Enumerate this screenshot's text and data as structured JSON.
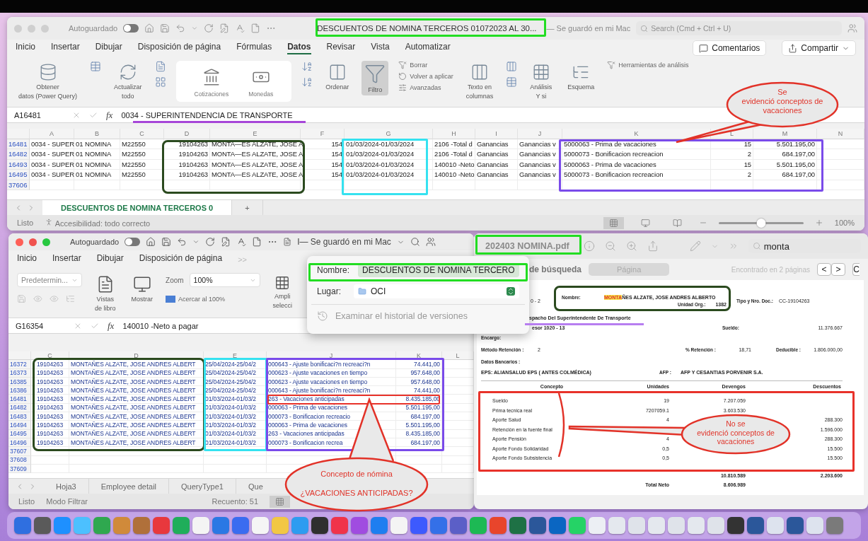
{
  "top_window": {
    "autosave": {
      "label": "Autoguardado",
      "on": false
    },
    "title": "DESCUENTOS DE NOMINA TERCEROS 01072023 AL 30...",
    "save_status": "— Se guardó en mi Mac",
    "search": {
      "placeholder": "Search (Cmd + Ctrl + U)"
    },
    "tabs": [
      {
        "label": "Inicio",
        "selected": false
      },
      {
        "label": "Insertar",
        "selected": false
      },
      {
        "label": "Dibujar",
        "selected": false
      },
      {
        "label": "Disposición de página",
        "selected": false
      },
      {
        "label": "Fórmulas",
        "selected": false
      },
      {
        "label": "Datos",
        "selected": true
      },
      {
        "label": "Revisar",
        "selected": false
      },
      {
        "label": "Vista",
        "selected": false
      },
      {
        "label": "Automatizar",
        "selected": false
      }
    ],
    "comments_button": "Comentarios",
    "share_button": "Compartir",
    "ribbon": [
      {
        "kind": "big",
        "lines": [
          "Obtener",
          "datos (Power Query)"
        ]
      },
      {
        "kind": "icon"
      },
      {
        "kind": "big",
        "lines": [
          "Actualizar",
          "todo"
        ]
      },
      {
        "kind": "icon"
      },
      {
        "kind": "gallery",
        "items": [
          "Cotizaciones",
          "Monedas"
        ]
      },
      {
        "kind": "icon"
      },
      {
        "kind": "big",
        "lines": [
          "Ordenar"
        ]
      },
      {
        "kind": "toggle",
        "lines": [
          "Filtro"
        ],
        "on": true
      },
      {
        "kind": "list",
        "items": [
          "Borrar",
          "Volver a aplicar",
          "Avanzadas"
        ]
      },
      {
        "kind": "big",
        "lines": [
          "Texto en",
          "columnas"
        ]
      },
      {
        "kind": "icon"
      },
      {
        "kind": "big",
        "lines": [
          "Análisis",
          "Y si"
        ]
      },
      {
        "kind": "big",
        "lines": [
          "Esquema"
        ]
      },
      {
        "kind": "list",
        "items": [
          "Herramientas de análisis"
        ]
      }
    ],
    "formula_bar": {
      "cell": "A16481",
      "function_label": "fx",
      "formula": "0034 - SUPERINTENDENCIA DE TRANSPORTE"
    },
    "columns": [
      "A",
      "B",
      "C",
      "D",
      "E",
      "F",
      "G",
      "H",
      "I",
      "J",
      "K",
      "L",
      "M",
      "N"
    ],
    "rows": [
      {
        "number": "16481",
        "cells": [
          "0034 - SUPER",
          "01 NOMINA",
          "M22550",
          "19104263",
          "MONTA—ES ALZATE, JOSE A",
          "154",
          "01/03/2024-01/03/2024",
          "2106 -Total d",
          "Ganancias",
          "Ganancias v",
          "5000063 - Prima de vacaciones",
          "15",
          "5.501.195,00"
        ]
      },
      {
        "number": "16482",
        "cells": [
          "0034 - SUPER",
          "01 NOMINA",
          "M22550",
          "19104263",
          "MONTA—ES ALZATE, JOSE A",
          "154",
          "01/03/2024-01/03/2024",
          "2106 -Total d",
          "Ganancias",
          "Ganancias v",
          "5000073 - Bonificacion recreacion",
          "2",
          "684.197,00"
        ]
      },
      {
        "number": "16493",
        "cells": [
          "0034 - SUPER",
          "01 NOMINA",
          "M22550",
          "19104263",
          "MONTA—ES ALZATE, JOSE A",
          "154",
          "01/03/2024-01/03/2024",
          "140010 -Neto",
          "Ganancias",
          "Ganancias v",
          "5000063 - Prima de vacaciones",
          "15",
          "5.501.195,00"
        ]
      },
      {
        "number": "16495",
        "cells": [
          "0034 - SUPER",
          "01 NOMINA",
          "M22550",
          "19104263",
          "MONTA—ES ALZATE, JOSE A",
          "154",
          "01/03/2024-01/03/2024",
          "140010 -Neto",
          "Ganancias",
          "Ganancias v",
          "5000073 - Bonificacion recreacion",
          "2",
          "684.197,00"
        ]
      },
      {
        "number": "37606"
      }
    ],
    "sheet_tabs": [
      {
        "label": "DESCUENTOS DE NOMINA TERCEROS 0",
        "selected": true
      }
    ],
    "add_sheet": "+",
    "status": {
      "ready": "Listo",
      "accessibility": "Accesibilidad: todo correcto",
      "zoom": "100%",
      "zoom_slider": {
        "level": 0.5
      }
    }
  },
  "bottom_window": {
    "autosave": {
      "label": "Autoguardado",
      "on": false
    },
    "save_status": "I— Se guardó en mi Mac",
    "tabs": [
      "Inicio",
      "Insertar",
      "Dibujar",
      "Disposición de página"
    ],
    "more_tabs": ">>",
    "style_dropdown": "Predetermin...",
    "workbook_views": [
      "Vistas",
      "de libro"
    ],
    "show": "Mostrar",
    "zoom_label": "Zoom",
    "zoom_value": "100%",
    "zoom_100": "Acercar al 100%",
    "cut_button": [
      "Ampli",
      "selecci"
    ],
    "formula_bar": {
      "cell": "G16354",
      "function_label": "fx",
      "formula": "140010 -Neto a pagar"
    },
    "columns": [
      "C",
      "D",
      "E",
      "J",
      "K",
      "L"
    ],
    "rows": [
      {
        "number": "16372",
        "cells": [
          "19104263",
          "MONTAÑES ALZATE, JOSE ANDRES ALBERT",
          "25/04/2024-25/04/2",
          "000643 - Ajuste bonificaci?n recreaci?n",
          "74.441,00"
        ]
      },
      {
        "number": "16373",
        "cells": [
          "19104263",
          "MONTAÑES ALZATE, JOSE ANDRES ALBERT",
          "25/04/2024-25/04/2",
          "000623 - Ajuste vacaciones en tiempo",
          "957.648,00"
        ]
      },
      {
        "number": "16385",
        "cells": [
          "19104263",
          "MONTAÑES ALZATE, JOSE ANDRES ALBERT",
          "25/04/2024-25/04/2",
          "000623 - Ajuste vacaciones en tiempo",
          "957.648,00"
        ]
      },
      {
        "number": "16386",
        "cells": [
          "19104263",
          "MONTAÑES ALZATE, JOSE ANDRES ALBERT",
          "25/04/2024-25/04/2",
          "000643 - Ajuste bonificaci?n recreaci?n",
          "74.441,00"
        ]
      },
      {
        "number": "16481",
        "cells": [
          "19104263",
          "MONTAÑES ALZATE, JOSE ANDRES ALBERT",
          "01/03/2024-01/03/2",
          "263 - Vacaciones anticipadas",
          "8.435.185,00"
        ]
      },
      {
        "number": "16482",
        "cells": [
          "19104263",
          "MONTAÑES ALZATE, JOSE ANDRES ALBERT",
          "01/03/2024-01/03/2",
          "000063 - Prima de vacaciones",
          "5.501.195,00"
        ]
      },
      {
        "number": "16483",
        "cells": [
          "19104263",
          "MONTAÑES ALZATE, JOSE ANDRES ALBERT",
          "01/03/2024-01/03/2",
          "000073 - Bonificacion recreacio",
          "684.197,00"
        ]
      },
      {
        "number": "16494",
        "cells": [
          "19104263",
          "MONTAÑES ALZATE, JOSE ANDRES ALBERT",
          "01/03/2024-01/03/2",
          "000063 - Prima de vacaciones",
          "5.501.195,00"
        ]
      },
      {
        "number": "16495",
        "cells": [
          "19104263",
          "MONTAÑES ALZATE, JOSE ANDRES ALBERT",
          "01/03/2024-01/03/2",
          "263 - Vacaciones anticipadas",
          "8.435.185,00"
        ]
      },
      {
        "number": "16496",
        "cells": [
          "19104263",
          "MONTAÑES ALZATE, JOSE ANDRES ALBERT",
          "01/03/2024-01/03/2",
          "000073 - Bonificacion recrea",
          "684.197,00"
        ]
      },
      {
        "number": "37607"
      },
      {
        "number": "37608"
      },
      {
        "number": "37609"
      }
    ],
    "sheet_tabs": [
      "Hoja3",
      "Employee detail",
      "QueryType1",
      "Que"
    ],
    "status": {
      "ready": "Listo",
      "mode": "Modo Filtrar",
      "count": "Recuento: 51"
    }
  },
  "save_popover": {
    "name_label": "Nombre:",
    "name": "DESCUENTOS DE NOMINA TERCERO",
    "location_label": "Lugar:",
    "location": "OCI",
    "history": "Examinar el historial de versiones"
  },
  "pdf_window": {
    "title": "202403 NOMINA.pdf",
    "search": "monta",
    "scope": "de búsqueda",
    "segment": "Página",
    "found": "Encontrado en 2 páginas",
    "prev": "<",
    "next": ">",
    "cut_button": "C",
    "document": {
      "code": "0 - 2",
      "name_label": "Nombre:",
      "name": "MONTAÑES ALZATE, JOSE ANDRES ALBERTO",
      "unit_label": "Unidad Org.:",
      "unit": "1382",
      "doc_label": "Tipo y Nro. Doc.:",
      "doc": "CC-19104263",
      "office": "spacho Del Superintendente De Transporte",
      "position": "esor 1020 - 13",
      "salary_label": "Sueldo:",
      "salary": "11.376.667",
      "assignment_label": "Encargo:",
      "method_label": "Método Retención :",
      "method": "2",
      "retention_label": "% Retención :",
      "retention": "18,71",
      "deductible_label": "Deducible :",
      "deductible": "1.806.000,00",
      "bank_label": "Datos Bancarios :",
      "eps": "EPS: ALIANSALUD EPS ( ANTES COLMÉDICA)",
      "afp_label": "AFP :",
      "afp": "AFP Y CESANTIAS PORVENIR S.A.",
      "table_columns": [
        "Concepto",
        "Unidades",
        "Devengos",
        "Descuentos"
      ],
      "lines": [
        {
          "concept": "Sueldo",
          "units": "19",
          "earned": "7.207.059"
        },
        {
          "concept": "Prima tecnica real",
          "units": "7207059.1",
          "earned": "3.603.530"
        },
        {
          "concept": "Aporte Salud",
          "units": "4",
          "deducted": "288.300"
        },
        {
          "concept": "Retención en la fuente final",
          "deducted": "1.596.000"
        },
        {
          "concept": "Aporte Pensión",
          "units": "4",
          "deducted": "288.300"
        },
        {
          "concept": "Aporte Fondo Solidaridad",
          "units": "0,5",
          "deducted": "15.500"
        },
        {
          "concept": "Aporte Fondo Subsistencia",
          "units": "0,5",
          "deducted": "15.500"
        }
      ],
      "total_earned": "10.810.589",
      "total_deducted": "2.203.600",
      "net_label": "Total Neto",
      "net": "8.606.989"
    }
  },
  "callouts": [
    {
      "lines": [
        "Se",
        "evidenció conceptos de",
        "vacaciones"
      ]
    },
    {
      "lines": [
        "Concepto de nómina",
        "¿VACACIONES ANTICIPADAS?"
      ]
    },
    {
      "lines": [
        "No se",
        "evidenció conceptos de",
        "vacaciones"
      ]
    }
  ],
  "highlights": [
    {
      "kind": "frame",
      "color": "#22dd22"
    },
    {
      "kind": "underline",
      "color": "#a646d8"
    },
    {
      "kind": "frame",
      "color": "#2b4a1f"
    },
    {
      "kind": "frame",
      "color": "#35e2f0"
    },
    {
      "kind": "frame",
      "color": "#7a4bea"
    },
    {
      "kind": "frame",
      "color": "#22dd22"
    },
    {
      "kind": "frame",
      "color": "#22dd22"
    },
    {
      "kind": "frame",
      "color": "#2b4a1f"
    },
    {
      "kind": "frame",
      "color": "#35e2f0"
    },
    {
      "kind": "frame",
      "color": "#7a4bea"
    },
    {
      "kind": "frame",
      "color": "#e8322a"
    },
    {
      "kind": "frame",
      "color": "#2b4a1f"
    },
    {
      "kind": "underline",
      "color": "#b77ef0"
    },
    {
      "kind": "frame",
      "color": "#e8322a"
    }
  ],
  "dock": [
    {
      "color": "#2f6fe0"
    },
    {
      "color": "#5a5a5a"
    },
    {
      "color": "#1e90ff"
    },
    {
      "color": "#4cc0ff"
    },
    {
      "color": "#2fa84f"
    },
    {
      "color": "#d08a3a"
    },
    {
      "color": "#b0703a"
    },
    {
      "color": "#e8383d"
    },
    {
      "color": "#1fae5a"
    },
    {
      "color": "#f4f4f4"
    },
    {
      "color": "#2a78e4"
    },
    {
      "color": "#3a6cf0"
    },
    {
      "color": "#f5f5f5"
    },
    {
      "color": "#f2c744"
    },
    {
      "color": "#2d9cf0"
    },
    {
      "color": "#2f2f2f"
    },
    {
      "color": "#f0334a"
    },
    {
      "color": "#a04ce0"
    },
    {
      "color": "#1e7ef0"
    },
    {
      "color": "#f4f4f4"
    },
    {
      "color": "#3d5afe"
    },
    {
      "color": "#3470e8"
    },
    {
      "color": "#5b5fc7"
    },
    {
      "color": "#1db954"
    },
    {
      "color": "#e8452c"
    },
    {
      "color": "#1e7145"
    },
    {
      "color": "#2b579a"
    },
    {
      "color": "#0a66c2"
    },
    {
      "color": "#25d366"
    },
    {
      "color": "#eceff4"
    },
    {
      "color": "#e4e8ee"
    },
    {
      "color": "#dfe3ea"
    },
    {
      "color": "#e4e8ee"
    },
    {
      "color": "#dfe3ea"
    },
    {
      "color": "#e4e8ee"
    },
    {
      "color": "#dfe3ea"
    },
    {
      "color": "#333333"
    },
    {
      "color": "#2b579a"
    },
    {
      "color": "#dde3ee"
    },
    {
      "color": "#2b579a"
    },
    {
      "color": "#dde3ee"
    },
    {
      "color": "#7a7a7a"
    }
  ]
}
